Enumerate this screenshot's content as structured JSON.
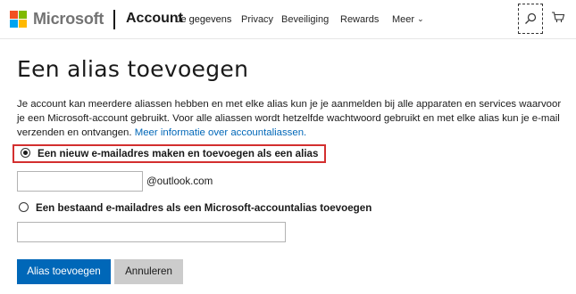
{
  "header": {
    "brand": "Microsoft",
    "section": "Account",
    "nav": [
      {
        "label": "Je gegevens"
      },
      {
        "label": "Privacy"
      },
      {
        "label": "Beveiliging"
      },
      {
        "label": "Rewards"
      },
      {
        "label": "Meer"
      }
    ],
    "icons": {
      "search": "search-icon",
      "cart": "cart-icon",
      "more": "chevron-down-icon"
    }
  },
  "page": {
    "title": "Een alias toevoegen",
    "intro": "Je account kan meerdere aliassen hebben en met elke alias kun je je aanmelden bij alle apparaten en services waarvoor je een Microsoft-account gebruikt. Voor alle aliassen wordt hetzelfde wachtwoord gebruikt en met elke alias kun je e-mail verzenden en ontvangen.",
    "intro_link": "Meer informatie over accountaliassen."
  },
  "form": {
    "option_new": {
      "label": "Een nieuw e-mailadres maken en toevoegen als een alias",
      "selected": true
    },
    "new_input": {
      "value": "",
      "placeholder": ""
    },
    "domain_suffix": "@outlook.com",
    "option_existing": {
      "label": "Een bestaand e-mailadres als een Microsoft-accountalias toevoegen",
      "selected": false
    },
    "existing_input": {
      "value": "",
      "placeholder": ""
    }
  },
  "actions": {
    "submit": "Alias toevoegen",
    "cancel": "Annuleren"
  },
  "colors": {
    "accent": "#0067b8",
    "highlight": "#d32f2f",
    "secondary_button": "#cccccc"
  }
}
